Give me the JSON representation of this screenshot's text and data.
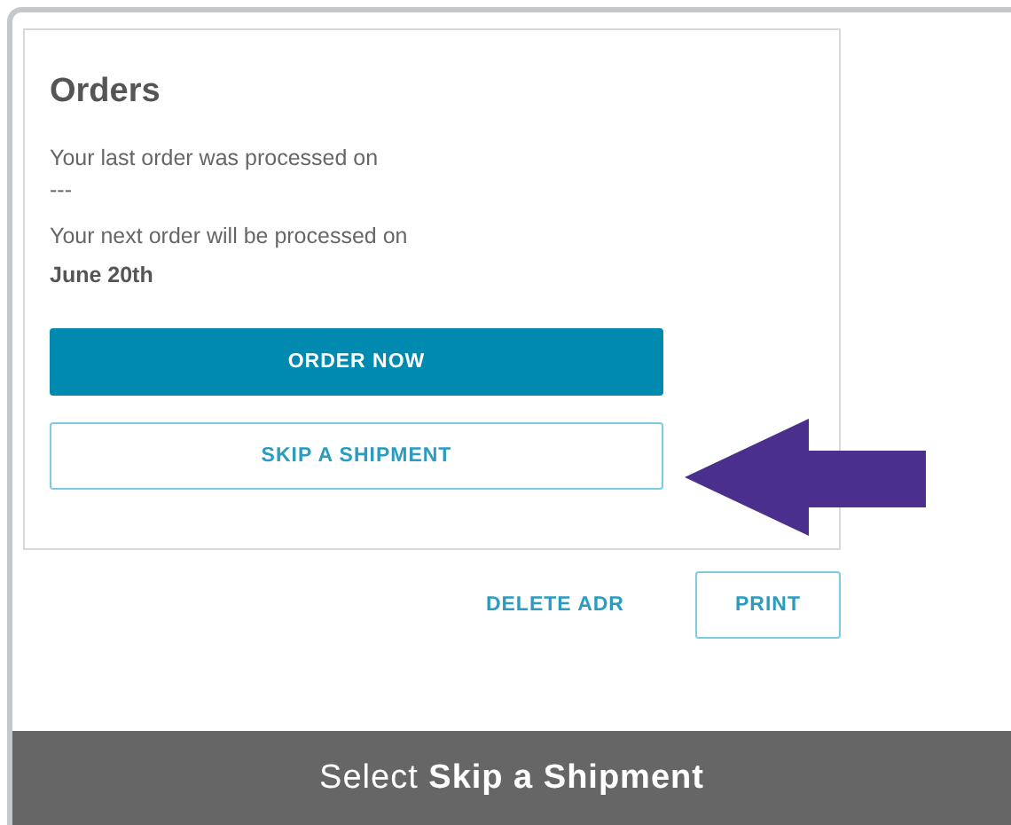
{
  "card": {
    "title": "Orders",
    "lines": [
      {
        "kind": "label",
        "text": "Your last order was processed on"
      },
      {
        "kind": "value",
        "text": "---"
      },
      {
        "kind": "label",
        "text": "Your next order will be processed on"
      },
      {
        "kind": "strong",
        "text": "June 20th"
      }
    ],
    "buttons": [
      {
        "kind": "primary",
        "label": "ORDER NOW"
      },
      {
        "kind": "outline",
        "label": "SKIP A SHIPMENT"
      }
    ]
  },
  "actions": [
    {
      "kind": "link",
      "label": "DELETE ADR"
    },
    {
      "kind": "outline",
      "label": "PRINT"
    }
  ],
  "caption": "Select **Skip a Shipment**"
}
